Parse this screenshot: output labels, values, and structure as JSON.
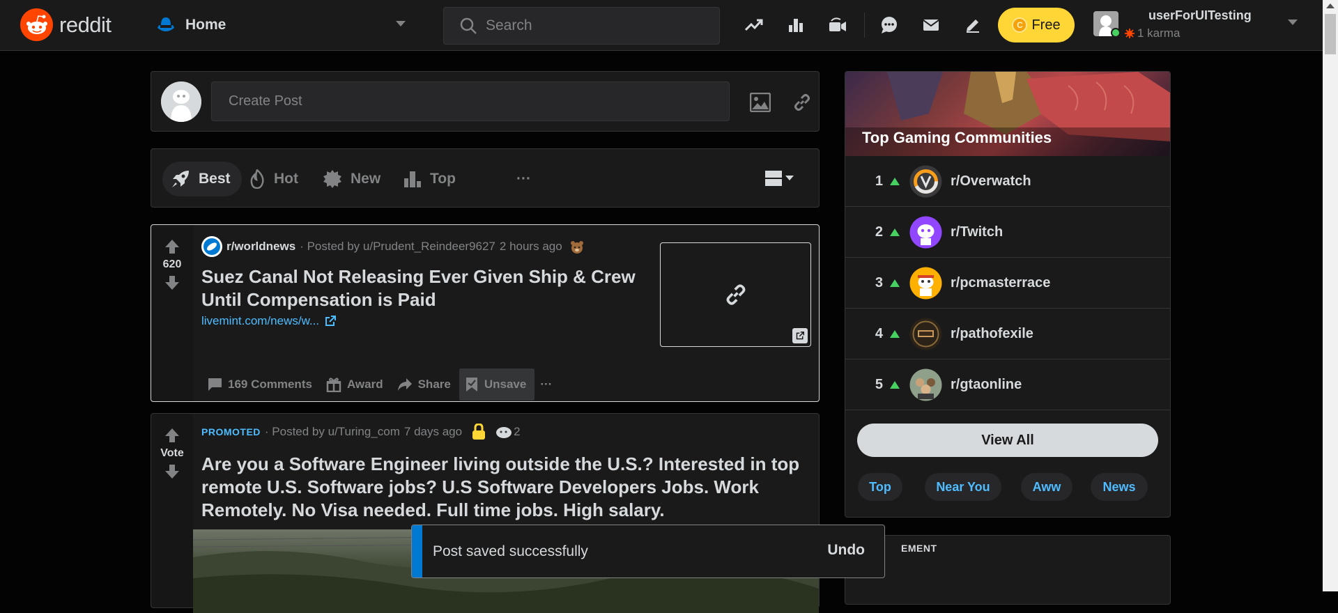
{
  "header": {
    "logo_text": "reddit",
    "home_label": "Home",
    "search_placeholder": "Search",
    "free_label": "Free",
    "user_name": "userForUITesting",
    "karma": "1 karma"
  },
  "create_post": {
    "placeholder": "Create Post"
  },
  "sort": {
    "items": [
      {
        "label": "Best",
        "icon": "rocket-icon",
        "active": true
      },
      {
        "label": "Hot",
        "icon": "flame-icon",
        "active": false
      },
      {
        "label": "New",
        "icon": "badge-icon",
        "active": false
      },
      {
        "label": "Top",
        "icon": "top-chart-icon",
        "active": false
      }
    ],
    "more": "···"
  },
  "post": {
    "votes": "620",
    "subreddit": "r/worldnews",
    "posted_by": "· Posted by u/Prudent_Reindeer9627",
    "time": "2 hours ago",
    "title": "Suez Canal Not Releasing Ever Given Ship & Crew Until Compensation is Paid",
    "link": "livemint.com/news/w...",
    "actions": {
      "comments": "169 Comments",
      "award": "Award",
      "share": "Share",
      "unsave": "Unsave",
      "more": "···"
    }
  },
  "promoted": {
    "vote_label": "Vote",
    "tag": "PROMOTED",
    "posted_by": "· Posted by u/Turing_com",
    "time": "7 days ago",
    "award_count": "2",
    "title": "Are you a Software Engineer living outside the U.S.? Interested in top remote U.S. Software jobs? U.S Software Developers Jobs. Work Remotely. No Visa needed. Full time jobs. High salary."
  },
  "sidebar": {
    "title": "Top Gaming Communities",
    "communities": [
      {
        "rank": "1",
        "name": "r/Overwatch"
      },
      {
        "rank": "2",
        "name": "r/Twitch"
      },
      {
        "rank": "3",
        "name": "r/pcmasterrace"
      },
      {
        "rank": "4",
        "name": "r/pathofexile"
      },
      {
        "rank": "5",
        "name": "r/gtaonline"
      }
    ],
    "view_all": "View All",
    "chips": [
      "Top",
      "Near You",
      "Aww",
      "News"
    ]
  },
  "ad_card": {
    "label": "EMENT"
  },
  "toast": {
    "message": "Post saved successfully",
    "undo": "Undo"
  },
  "colors": {
    "accent": "#ff4500",
    "link": "#4fbcff",
    "upvote_green": "#46d160",
    "coins_yellow": "#ffd635",
    "toast_bar": "#0079d3"
  }
}
